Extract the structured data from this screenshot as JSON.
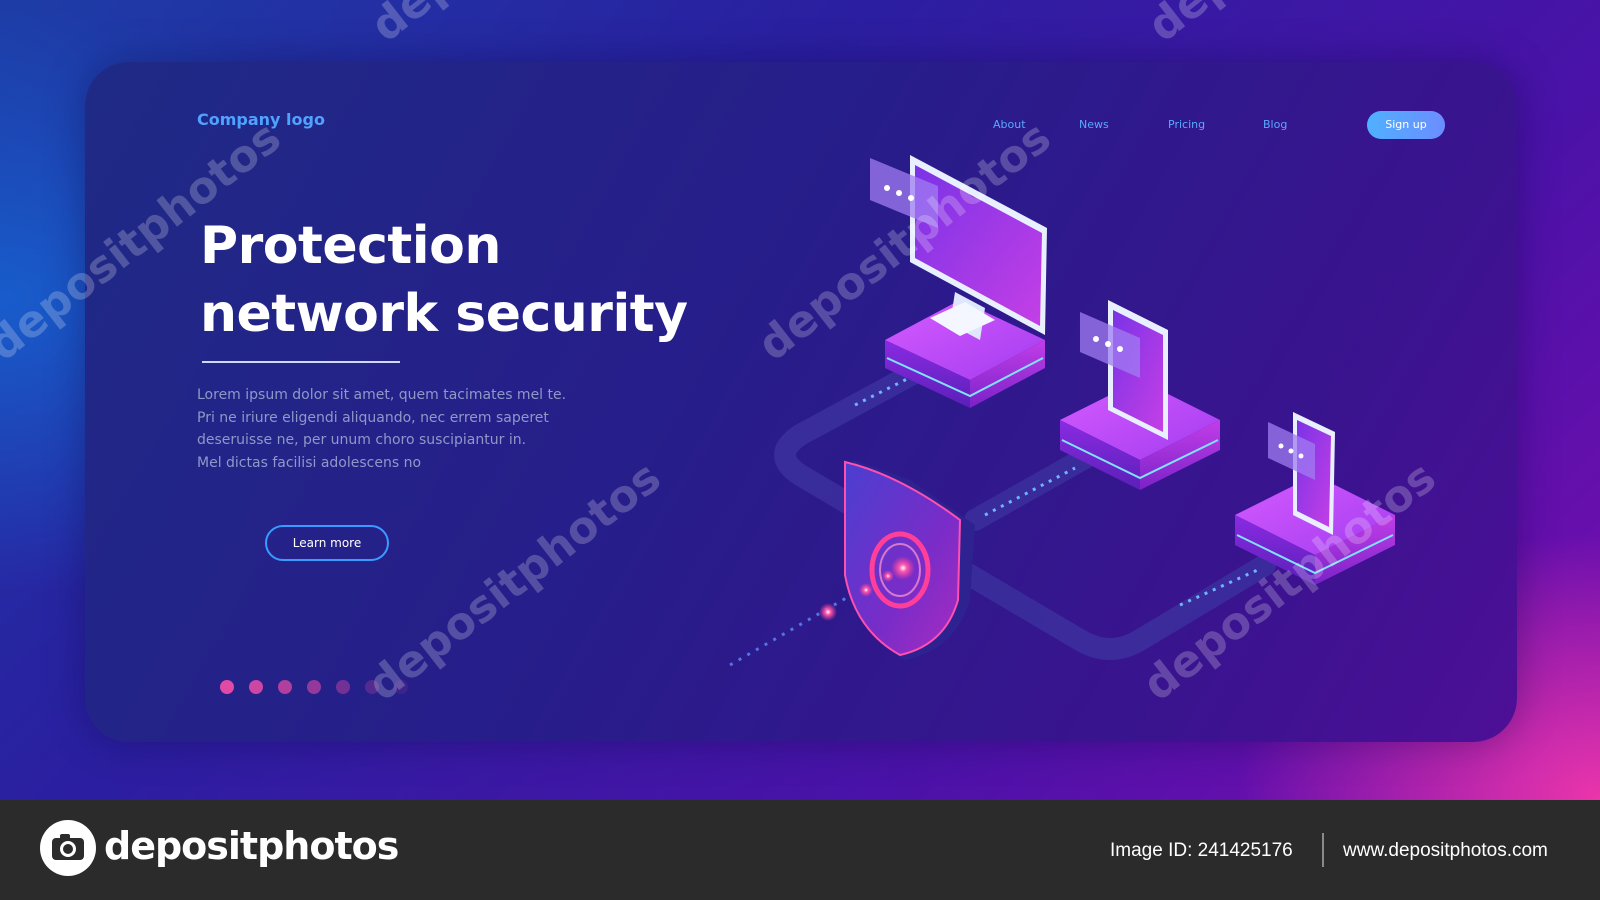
{
  "header": {
    "logo": "Company logo",
    "nav": [
      "About",
      "News",
      "Pricing",
      "Blog"
    ],
    "signup": "Sign up"
  },
  "hero": {
    "title_line1": "Protection",
    "title_line2": "network security",
    "description": [
      "Lorem ipsum dolor sit amet, quem tacimates mel te.",
      "Pri ne iriure eligendi aliquando, nec errem saperet",
      "deseruisse ne, per unum choro suscipiantur in.",
      "Mel dictas facilisi adolescens no"
    ],
    "cta": "Learn more",
    "slides_total": 7,
    "slide_active": 1
  },
  "watermark": {
    "text": "depositphotos",
    "short": "dep"
  },
  "footer": {
    "brand": "depositphotos",
    "image_id": "Image ID: 241425176",
    "url": "www.depositphotos.com"
  },
  "colors": {
    "accent_blue": "#4fa3ff",
    "accent_pink": "#e04aa6",
    "card_bg": "#271d8a",
    "footer_bg": "#2b2b2b"
  },
  "icons": [
    "monitor-icon",
    "tablet-icon",
    "phone-icon",
    "shield-icon",
    "chat-bubble-icon",
    "camera-icon"
  ]
}
